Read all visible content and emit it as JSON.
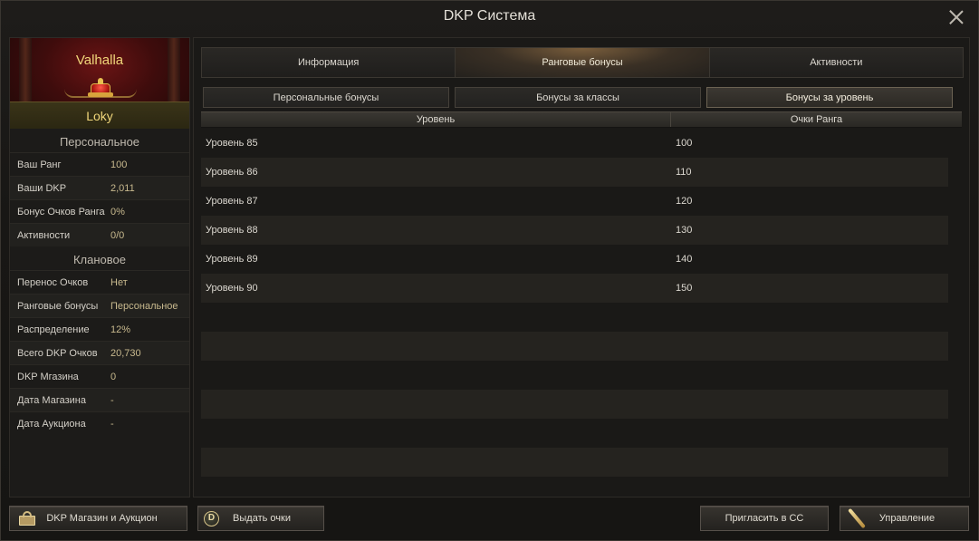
{
  "window": {
    "title": "DKP Система"
  },
  "guild": {
    "name": "Valhalla",
    "player": "Loky"
  },
  "personal": {
    "title": "Персональное",
    "rows": [
      {
        "label": "Ваш Ранг",
        "value": "100"
      },
      {
        "label": "Ваши DKP",
        "value": "2,011"
      },
      {
        "label": "Бонус Очков Ранга",
        "value": "0%"
      },
      {
        "label": "Активности",
        "value": "0/0"
      }
    ]
  },
  "clan": {
    "title": "Клановое",
    "rows": [
      {
        "label": "Перенос Очков",
        "value": "Нет"
      },
      {
        "label": "Ранговые бонусы",
        "value": "Персональное"
      },
      {
        "label": "Распределение",
        "value": "12%"
      },
      {
        "label": "Всего DKP Очков",
        "value": "20,730"
      },
      {
        "label": "DKP Мгазина",
        "value": "0"
      },
      {
        "label": "Дата Магазина",
        "value": "-"
      },
      {
        "label": "Дата Аукциона",
        "value": "-"
      }
    ]
  },
  "tabs": [
    "Информация",
    "Ранговые бонусы",
    "Активности"
  ],
  "active_tab": "Ранговые бонусы",
  "subtabs": [
    "Персональные бонусы",
    "Бонусы за классы",
    "Бонусы за уровень"
  ],
  "active_subtab": "Бонусы за уровень",
  "table": {
    "headers": [
      "Уровень",
      "Очки Ранга"
    ],
    "rows": [
      [
        "Уровень 85",
        "100"
      ],
      [
        "Уровень 86",
        "110"
      ],
      [
        "Уровень 87",
        "120"
      ],
      [
        "Уровень 88",
        "130"
      ],
      [
        "Уровень 89",
        "140"
      ],
      [
        "Уровень 90",
        "150"
      ],
      [
        "",
        ""
      ],
      [
        "",
        ""
      ],
      [
        "",
        ""
      ],
      [
        "",
        ""
      ],
      [
        "",
        ""
      ],
      [
        "",
        ""
      ]
    ]
  },
  "buttons": {
    "shop": "DKP Магазин и Аукцион",
    "give_points": "Выдать очки",
    "coin_letter": "D",
    "invite": "Пригласить в СС",
    "manage": "Управление"
  },
  "icons": {
    "shop": "shop-icon",
    "coin": "dkp-coin-icon",
    "manage": "feather-icon",
    "close": "close-icon"
  }
}
